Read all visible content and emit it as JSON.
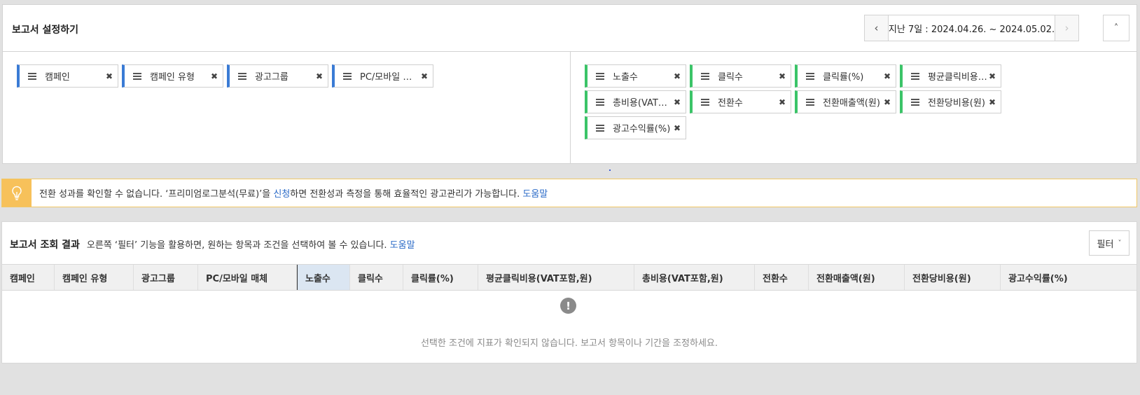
{
  "settings": {
    "title": "보고서 설정하기",
    "date_range": "지난 7일 : 2024.04.26. ~ 2024.05.02.",
    "dimensions": [
      {
        "label": "캠페인"
      },
      {
        "label": "캠페인 유형"
      },
      {
        "label": "광고그룹"
      },
      {
        "label": "PC/모바일 매체"
      }
    ],
    "metrics": [
      {
        "label": "노출수"
      },
      {
        "label": "클릭수"
      },
      {
        "label": "클릭률(%)"
      },
      {
        "label": "평균클릭비용(VAT포함,원)"
      },
      {
        "label": "총비용(VAT포함,원)"
      },
      {
        "label": "전환수"
      },
      {
        "label": "전환매출액(원)"
      },
      {
        "label": "전환당비용(원)"
      },
      {
        "label": "광고수익률(%)"
      }
    ]
  },
  "notice": {
    "text_1": "전환 성과를 확인할 수 없습니다. ‘프리미엄로그분석(무료)’을 ",
    "apply_link": "신청",
    "text_2": "하면 전환성과 측정을 통해 효율적인 광고관리가 가능합니다. ",
    "help_link": "도움말"
  },
  "results": {
    "title": "보고서 조회 결과",
    "desc": "오른쪽 ‘필터’ 기능을 활용하면, 원하는 항목과 조건을 선택하여 볼 수 있습니다. ",
    "help_link": "도움말",
    "filter_label": "필터",
    "columns": [
      "캠페인",
      "캠페인 유형",
      "광고그룹",
      "PC/모바일 매체",
      "노출수",
      "클릭수",
      "클릭률(%)",
      "평균클릭비용(VAT포함,원)",
      "총비용(VAT포함,원)",
      "전환수",
      "전환매출액(원)",
      "전환당비용(원)",
      "광고수익률(%)"
    ],
    "active_column": "노출수",
    "empty_message": "선택한 조건에 지표가 확인되지 않습니다. 보고서 항목이나 기간을 조정하세요."
  },
  "colors": {
    "dimension_chip_accent": "#3a7bd5",
    "metric_chip_accent": "#3bc468",
    "notice_accent": "#f7c15a",
    "link": "#2a6ac7"
  }
}
